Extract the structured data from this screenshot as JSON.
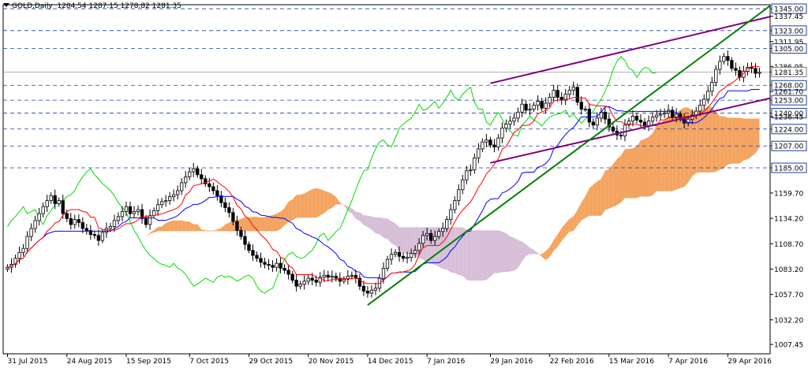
{
  "header": {
    "symbol": "GOLD",
    "timeframe": "Daily",
    "ohlc": "1284.54 1287.15 1278.82 1281.35"
  },
  "chart_data": {
    "type": "candlestick",
    "price_axis": {
      "range": [
        998,
        1349
      ],
      "ticks": [
        1345.0,
        1337.45,
        1323.0,
        1311.95,
        1305.0,
        1286.95,
        1281.35,
        1268.0,
        1261.7,
        1253.0,
        1240.0,
        1236.45,
        1224.0,
        1207.0,
        1185.0,
        1159.7,
        1134.2,
        1108.7,
        1083.2,
        1057.7,
        1032.2,
        1007.45
      ],
      "highlighted": [
        1345.0,
        1323.0,
        1305.0,
        1281.35,
        1268.0,
        1253.0,
        1240.0,
        1224.0,
        1207.0,
        1185.0
      ],
      "current": 1281.35
    },
    "time_axis": {
      "labels": [
        "31 Jul 2015",
        "24 Aug 2015",
        "15 Sep 2015",
        "7 Oct 2015",
        "29 Oct 2015",
        "20 Nov 2015",
        "14 Dec 2015",
        "7 Jan 2016",
        "29 Jan 2016",
        "22 Feb 2016",
        "15 Mar 2016",
        "7 Apr 2016",
        "29 Apr 2016"
      ]
    },
    "levels": [
      1345.0,
      1323.0,
      1305.0,
      1268.0,
      1253.0,
      1240.0,
      1224.0,
      1207.0,
      1185.0
    ],
    "close_series": [
      1085,
      1088,
      1094,
      1100,
      1104,
      1116,
      1124,
      1132,
      1139,
      1146,
      1152,
      1157,
      1149,
      1152,
      1139,
      1134,
      1128,
      1133,
      1130,
      1124,
      1122,
      1118,
      1117,
      1112,
      1120,
      1124,
      1126,
      1132,
      1136,
      1141,
      1146,
      1139,
      1141,
      1143,
      1134,
      1128,
      1137,
      1142,
      1148,
      1151,
      1152,
      1156,
      1158,
      1162,
      1170,
      1176,
      1181,
      1184,
      1178,
      1174,
      1169,
      1166,
      1162,
      1157,
      1150,
      1145,
      1140,
      1131,
      1122,
      1116,
      1108,
      1102,
      1097,
      1094,
      1090,
      1088,
      1087,
      1085,
      1089,
      1084,
      1082,
      1078,
      1072,
      1066,
      1068,
      1071,
      1074,
      1072,
      1070,
      1075,
      1077,
      1075,
      1076,
      1074,
      1071,
      1073,
      1076,
      1077,
      1074,
      1066,
      1061,
      1059,
      1062,
      1064,
      1074,
      1084,
      1093,
      1098,
      1100,
      1096,
      1094,
      1095,
      1099,
      1102,
      1109,
      1117,
      1119,
      1112,
      1116,
      1121,
      1124,
      1133,
      1143,
      1152,
      1163,
      1173,
      1182,
      1183,
      1195,
      1204,
      1211,
      1213,
      1208,
      1206,
      1215,
      1225,
      1229,
      1232,
      1235,
      1241,
      1249,
      1243,
      1244,
      1248,
      1252,
      1245,
      1250,
      1256,
      1263,
      1256,
      1253,
      1259,
      1263,
      1266,
      1251,
      1244,
      1244,
      1231,
      1228,
      1235,
      1241,
      1234,
      1226,
      1222,
      1218,
      1217,
      1228,
      1232,
      1237,
      1233,
      1231,
      1227,
      1232,
      1236,
      1238,
      1239,
      1240,
      1243,
      1236,
      1239,
      1234,
      1230,
      1234,
      1238,
      1242,
      1248,
      1254,
      1262,
      1271,
      1284,
      1292,
      1297,
      1293,
      1285,
      1283,
      1276,
      1282,
      1286,
      1285,
      1280,
      1281
    ],
    "overlay": {
      "upper_channel": {
        "from": [
          "29 Jan 2016",
          1270
        ],
        "to": [
          "end",
          1337
        ]
      },
      "lower_channel": {
        "from": [
          "29 Jan 2016",
          1190
        ],
        "to": [
          "end",
          1255
        ]
      },
      "trendline": {
        "from": [
          "14 Dec 2015",
          1047
        ],
        "to": [
          "end",
          1348
        ]
      }
    },
    "colors": {
      "bull": "#ffffff",
      "bear": "#000000",
      "tenkan": "#ff0000",
      "kijun": "#0000ff",
      "chikou": "#00dd00",
      "cloud_bull": "#f4a460",
      "cloud_bear": "#d8bfd8",
      "channel": "#800080",
      "trendline": "#008000",
      "level": "#1a3fa0"
    },
    "grid": false
  }
}
